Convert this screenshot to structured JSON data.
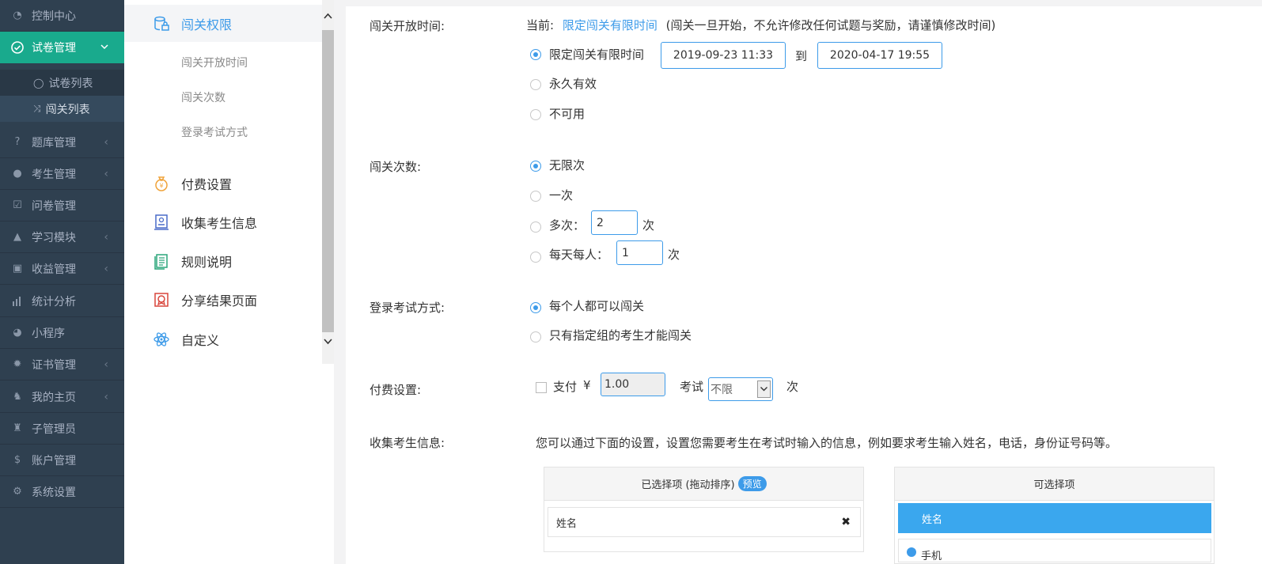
{
  "sidebar": {
    "items": [
      {
        "label": "控制中心",
        "icon": "dashboard-icon"
      },
      {
        "label": "试卷管理",
        "icon": "check-circle-icon",
        "active": true
      },
      {
        "label": "题库管理",
        "icon": "question-circle-icon"
      },
      {
        "label": "考生管理",
        "icon": "user-icon"
      },
      {
        "label": "问卷管理",
        "icon": "checkbox-icon"
      },
      {
        "label": "学习模块",
        "icon": "graduation-cap-icon"
      },
      {
        "label": "收益管理",
        "icon": "money-icon"
      },
      {
        "label": "统计分析",
        "icon": "bar-chart-icon"
      },
      {
        "label": "小程序",
        "icon": "wechat-icon"
      },
      {
        "label": "证书管理",
        "icon": "certificate-icon"
      },
      {
        "label": "我的主页",
        "icon": "home-icon"
      },
      {
        "label": "子管理员",
        "icon": "admin-icon"
      },
      {
        "label": "账户管理",
        "icon": "dollar-icon"
      },
      {
        "label": "系统设置",
        "icon": "gear-icon"
      }
    ],
    "subitems": [
      {
        "label": "试卷列表",
        "icon": "check-circle-icon"
      },
      {
        "label": "闯关列表",
        "icon": "shuffle-icon"
      }
    ]
  },
  "midnav": {
    "sections": [
      {
        "label": "闯关权限",
        "icon": "database-lock-icon"
      },
      {
        "label": "付费设置",
        "icon": "money-bag-icon"
      },
      {
        "label": "收集考生信息",
        "icon": "id-card-icon"
      },
      {
        "label": "规则说明",
        "icon": "document-icon"
      },
      {
        "label": "分享结果页面",
        "icon": "share-badge-icon"
      },
      {
        "label": "自定义",
        "icon": "atom-icon"
      }
    ],
    "subs": [
      "闯关开放时间",
      "闯关次数",
      "登录考试方式"
    ]
  },
  "open_time": {
    "label": "闯关开放时间:",
    "current_prefix": "当前:",
    "current_value": "限定闯关有限时间",
    "current_note": "(闯关一旦开始，不允许修改任何试题与奖励，请谨慎修改时间)",
    "options": [
      "限定闯关有限时间",
      "永久有效",
      "不可用"
    ],
    "selected": 0,
    "start": "2019-09-23 11:33",
    "to": "到",
    "end": "2020-04-17 19:55"
  },
  "attempts": {
    "label": "闯关次数:",
    "options": [
      "无限次",
      "一次",
      "多次：",
      "每天每人："
    ],
    "selected": 0,
    "multi_value": "2",
    "daily_value": "1",
    "unit": "次"
  },
  "login": {
    "label": "登录考试方式:",
    "options": [
      "每个人都可以闯关",
      "只有指定组的考生才能闯关"
    ],
    "selected": 0
  },
  "payment": {
    "label": "付费设置:",
    "pay_label": "支付",
    "currency": "¥",
    "amount": "1.00",
    "exam_label": "考试",
    "exam_select": "不限",
    "unit": "次"
  },
  "collect": {
    "label": "收集考生信息:",
    "desc": "您可以通过下面的设置，设置您需要考生在考试时输入的信息，例如要求考生输入姓名，电话，身份证号码等。",
    "selected_title": "已选择项 (拖动排序)",
    "preview": "预览",
    "selected_items": [
      "姓名"
    ],
    "available_title": "可选择项",
    "available_items": [
      "姓名",
      "手机"
    ]
  },
  "colors": {
    "accent": "#3d9be9",
    "sidebar": "#2f4050",
    "active": "#19aa8d"
  }
}
